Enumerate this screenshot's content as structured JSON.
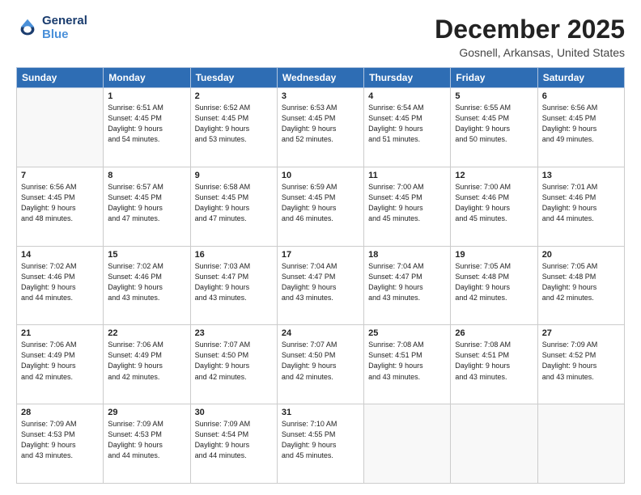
{
  "logo": {
    "line1": "General",
    "line2": "Blue"
  },
  "title": "December 2025",
  "subtitle": "Gosnell, Arkansas, United States",
  "weekdays": [
    "Sunday",
    "Monday",
    "Tuesday",
    "Wednesday",
    "Thursday",
    "Friday",
    "Saturday"
  ],
  "weeks": [
    [
      {
        "day": "",
        "sunrise": "",
        "sunset": "",
        "daylight": "",
        "empty": true
      },
      {
        "day": "1",
        "sunrise": "Sunrise: 6:51 AM",
        "sunset": "Sunset: 4:45 PM",
        "daylight": "Daylight: 9 hours and 54 minutes.",
        "empty": false
      },
      {
        "day": "2",
        "sunrise": "Sunrise: 6:52 AM",
        "sunset": "Sunset: 4:45 PM",
        "daylight": "Daylight: 9 hours and 53 minutes.",
        "empty": false
      },
      {
        "day": "3",
        "sunrise": "Sunrise: 6:53 AM",
        "sunset": "Sunset: 4:45 PM",
        "daylight": "Daylight: 9 hours and 52 minutes.",
        "empty": false
      },
      {
        "day": "4",
        "sunrise": "Sunrise: 6:54 AM",
        "sunset": "Sunset: 4:45 PM",
        "daylight": "Daylight: 9 hours and 51 minutes.",
        "empty": false
      },
      {
        "day": "5",
        "sunrise": "Sunrise: 6:55 AM",
        "sunset": "Sunset: 4:45 PM",
        "daylight": "Daylight: 9 hours and 50 minutes.",
        "empty": false
      },
      {
        "day": "6",
        "sunrise": "Sunrise: 6:56 AM",
        "sunset": "Sunset: 4:45 PM",
        "daylight": "Daylight: 9 hours and 49 minutes.",
        "empty": false
      }
    ],
    [
      {
        "day": "7",
        "sunrise": "Sunrise: 6:56 AM",
        "sunset": "Sunset: 4:45 PM",
        "daylight": "Daylight: 9 hours and 48 minutes.",
        "empty": false
      },
      {
        "day": "8",
        "sunrise": "Sunrise: 6:57 AM",
        "sunset": "Sunset: 4:45 PM",
        "daylight": "Daylight: 9 hours and 47 minutes.",
        "empty": false
      },
      {
        "day": "9",
        "sunrise": "Sunrise: 6:58 AM",
        "sunset": "Sunset: 4:45 PM",
        "daylight": "Daylight: 9 hours and 47 minutes.",
        "empty": false
      },
      {
        "day": "10",
        "sunrise": "Sunrise: 6:59 AM",
        "sunset": "Sunset: 4:45 PM",
        "daylight": "Daylight: 9 hours and 46 minutes.",
        "empty": false
      },
      {
        "day": "11",
        "sunrise": "Sunrise: 7:00 AM",
        "sunset": "Sunset: 4:45 PM",
        "daylight": "Daylight: 9 hours and 45 minutes.",
        "empty": false
      },
      {
        "day": "12",
        "sunrise": "Sunrise: 7:00 AM",
        "sunset": "Sunset: 4:46 PM",
        "daylight": "Daylight: 9 hours and 45 minutes.",
        "empty": false
      },
      {
        "day": "13",
        "sunrise": "Sunrise: 7:01 AM",
        "sunset": "Sunset: 4:46 PM",
        "daylight": "Daylight: 9 hours and 44 minutes.",
        "empty": false
      }
    ],
    [
      {
        "day": "14",
        "sunrise": "Sunrise: 7:02 AM",
        "sunset": "Sunset: 4:46 PM",
        "daylight": "Daylight: 9 hours and 44 minutes.",
        "empty": false
      },
      {
        "day": "15",
        "sunrise": "Sunrise: 7:02 AM",
        "sunset": "Sunset: 4:46 PM",
        "daylight": "Daylight: 9 hours and 43 minutes.",
        "empty": false
      },
      {
        "day": "16",
        "sunrise": "Sunrise: 7:03 AM",
        "sunset": "Sunset: 4:47 PM",
        "daylight": "Daylight: 9 hours and 43 minutes.",
        "empty": false
      },
      {
        "day": "17",
        "sunrise": "Sunrise: 7:04 AM",
        "sunset": "Sunset: 4:47 PM",
        "daylight": "Daylight: 9 hours and 43 minutes.",
        "empty": false
      },
      {
        "day": "18",
        "sunrise": "Sunrise: 7:04 AM",
        "sunset": "Sunset: 4:47 PM",
        "daylight": "Daylight: 9 hours and 43 minutes.",
        "empty": false
      },
      {
        "day": "19",
        "sunrise": "Sunrise: 7:05 AM",
        "sunset": "Sunset: 4:48 PM",
        "daylight": "Daylight: 9 hours and 42 minutes.",
        "empty": false
      },
      {
        "day": "20",
        "sunrise": "Sunrise: 7:05 AM",
        "sunset": "Sunset: 4:48 PM",
        "daylight": "Daylight: 9 hours and 42 minutes.",
        "empty": false
      }
    ],
    [
      {
        "day": "21",
        "sunrise": "Sunrise: 7:06 AM",
        "sunset": "Sunset: 4:49 PM",
        "daylight": "Daylight: 9 hours and 42 minutes.",
        "empty": false
      },
      {
        "day": "22",
        "sunrise": "Sunrise: 7:06 AM",
        "sunset": "Sunset: 4:49 PM",
        "daylight": "Daylight: 9 hours and 42 minutes.",
        "empty": false
      },
      {
        "day": "23",
        "sunrise": "Sunrise: 7:07 AM",
        "sunset": "Sunset: 4:50 PM",
        "daylight": "Daylight: 9 hours and 42 minutes.",
        "empty": false
      },
      {
        "day": "24",
        "sunrise": "Sunrise: 7:07 AM",
        "sunset": "Sunset: 4:50 PM",
        "daylight": "Daylight: 9 hours and 42 minutes.",
        "empty": false
      },
      {
        "day": "25",
        "sunrise": "Sunrise: 7:08 AM",
        "sunset": "Sunset: 4:51 PM",
        "daylight": "Daylight: 9 hours and 43 minutes.",
        "empty": false
      },
      {
        "day": "26",
        "sunrise": "Sunrise: 7:08 AM",
        "sunset": "Sunset: 4:51 PM",
        "daylight": "Daylight: 9 hours and 43 minutes.",
        "empty": false
      },
      {
        "day": "27",
        "sunrise": "Sunrise: 7:09 AM",
        "sunset": "Sunset: 4:52 PM",
        "daylight": "Daylight: 9 hours and 43 minutes.",
        "empty": false
      }
    ],
    [
      {
        "day": "28",
        "sunrise": "Sunrise: 7:09 AM",
        "sunset": "Sunset: 4:53 PM",
        "daylight": "Daylight: 9 hours and 43 minutes.",
        "empty": false
      },
      {
        "day": "29",
        "sunrise": "Sunrise: 7:09 AM",
        "sunset": "Sunset: 4:53 PM",
        "daylight": "Daylight: 9 hours and 44 minutes.",
        "empty": false
      },
      {
        "day": "30",
        "sunrise": "Sunrise: 7:09 AM",
        "sunset": "Sunset: 4:54 PM",
        "daylight": "Daylight: 9 hours and 44 minutes.",
        "empty": false
      },
      {
        "day": "31",
        "sunrise": "Sunrise: 7:10 AM",
        "sunset": "Sunset: 4:55 PM",
        "daylight": "Daylight: 9 hours and 45 minutes.",
        "empty": false
      },
      {
        "day": "",
        "sunrise": "",
        "sunset": "",
        "daylight": "",
        "empty": true
      },
      {
        "day": "",
        "sunrise": "",
        "sunset": "",
        "daylight": "",
        "empty": true
      },
      {
        "day": "",
        "sunrise": "",
        "sunset": "",
        "daylight": "",
        "empty": true
      }
    ]
  ]
}
